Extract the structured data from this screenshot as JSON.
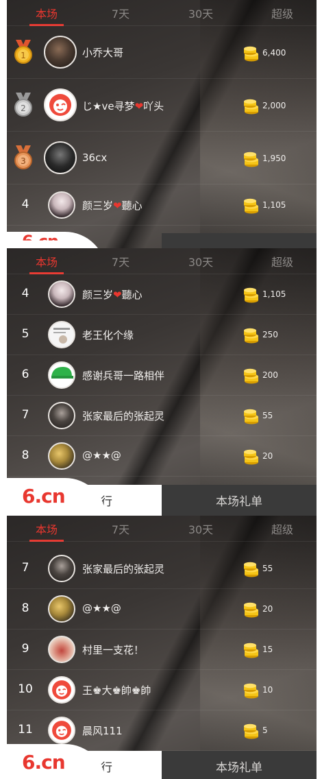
{
  "tabs": [
    {
      "label": "本场",
      "active": true
    },
    {
      "label": "7天",
      "active": false
    },
    {
      "label": "30天",
      "active": false
    },
    {
      "label": "超级",
      "active": false
    }
  ],
  "footer": {
    "logo": "6.cn",
    "ranking_label": "排行",
    "gift_list_label": "本场礼单"
  },
  "panel1": {
    "rows": [
      {
        "rank": "1",
        "medal": "gold",
        "avatar": "avatar-dark",
        "name": "小乔大哥",
        "amount": "6,400"
      },
      {
        "rank": "2",
        "medal": "silver",
        "avatar": "avatar-fox",
        "name_parts": [
          "じ★ve寻梦",
          "❤",
          "吖头"
        ],
        "amount": "2,000"
      },
      {
        "rank": "3",
        "medal": "bronze",
        "avatar": "avatar-black",
        "name": "36cx",
        "amount": "1,950"
      },
      {
        "rank": "4",
        "avatar": "avatar-girl",
        "name_parts": [
          "颜三岁",
          "❤",
          "聽心"
        ],
        "amount": "1,105"
      }
    ]
  },
  "panel2": {
    "rows": [
      {
        "rank": "4",
        "avatar": "avatar-girl",
        "name_parts": [
          "颜三岁",
          "❤",
          "聽心"
        ],
        "amount": "1,105"
      },
      {
        "rank": "5",
        "avatar": "avatar-text",
        "name": "老王化个缘",
        "amount": "250"
      },
      {
        "rank": "6",
        "avatar": "avatar-green",
        "name": "感谢兵哥一路相伴",
        "amount": "200"
      },
      {
        "rank": "7",
        "avatar": "avatar-man",
        "name": "张家最后的张起灵",
        "amount": "55"
      },
      {
        "rank": "8",
        "avatar": "avatar-gold",
        "name": "@★★@",
        "amount": "20"
      }
    ]
  },
  "panel3": {
    "rows": [
      {
        "rank": "7",
        "avatar": "avatar-man",
        "name": "张家最后的张起灵",
        "amount": "55"
      },
      {
        "rank": "8",
        "avatar": "avatar-gold",
        "name": "@★★@",
        "amount": "20"
      },
      {
        "rank": "9",
        "avatar": "avatar-lips",
        "name": "村里一支花！",
        "amount": "15"
      },
      {
        "rank": "10",
        "avatar": "avatar-fox",
        "name": "王♚大♚帥♚帥",
        "amount": "10"
      },
      {
        "rank": "11",
        "avatar": "avatar-fox",
        "name": "晨风111",
        "amount": "5"
      }
    ]
  },
  "colors": {
    "accent": "#e8372f",
    "coin": "#f5c518",
    "inactive_tab": "#8b8886"
  },
  "icons": {
    "coin": "coin-stack-icon",
    "medal": "rank-medal-icon"
  }
}
